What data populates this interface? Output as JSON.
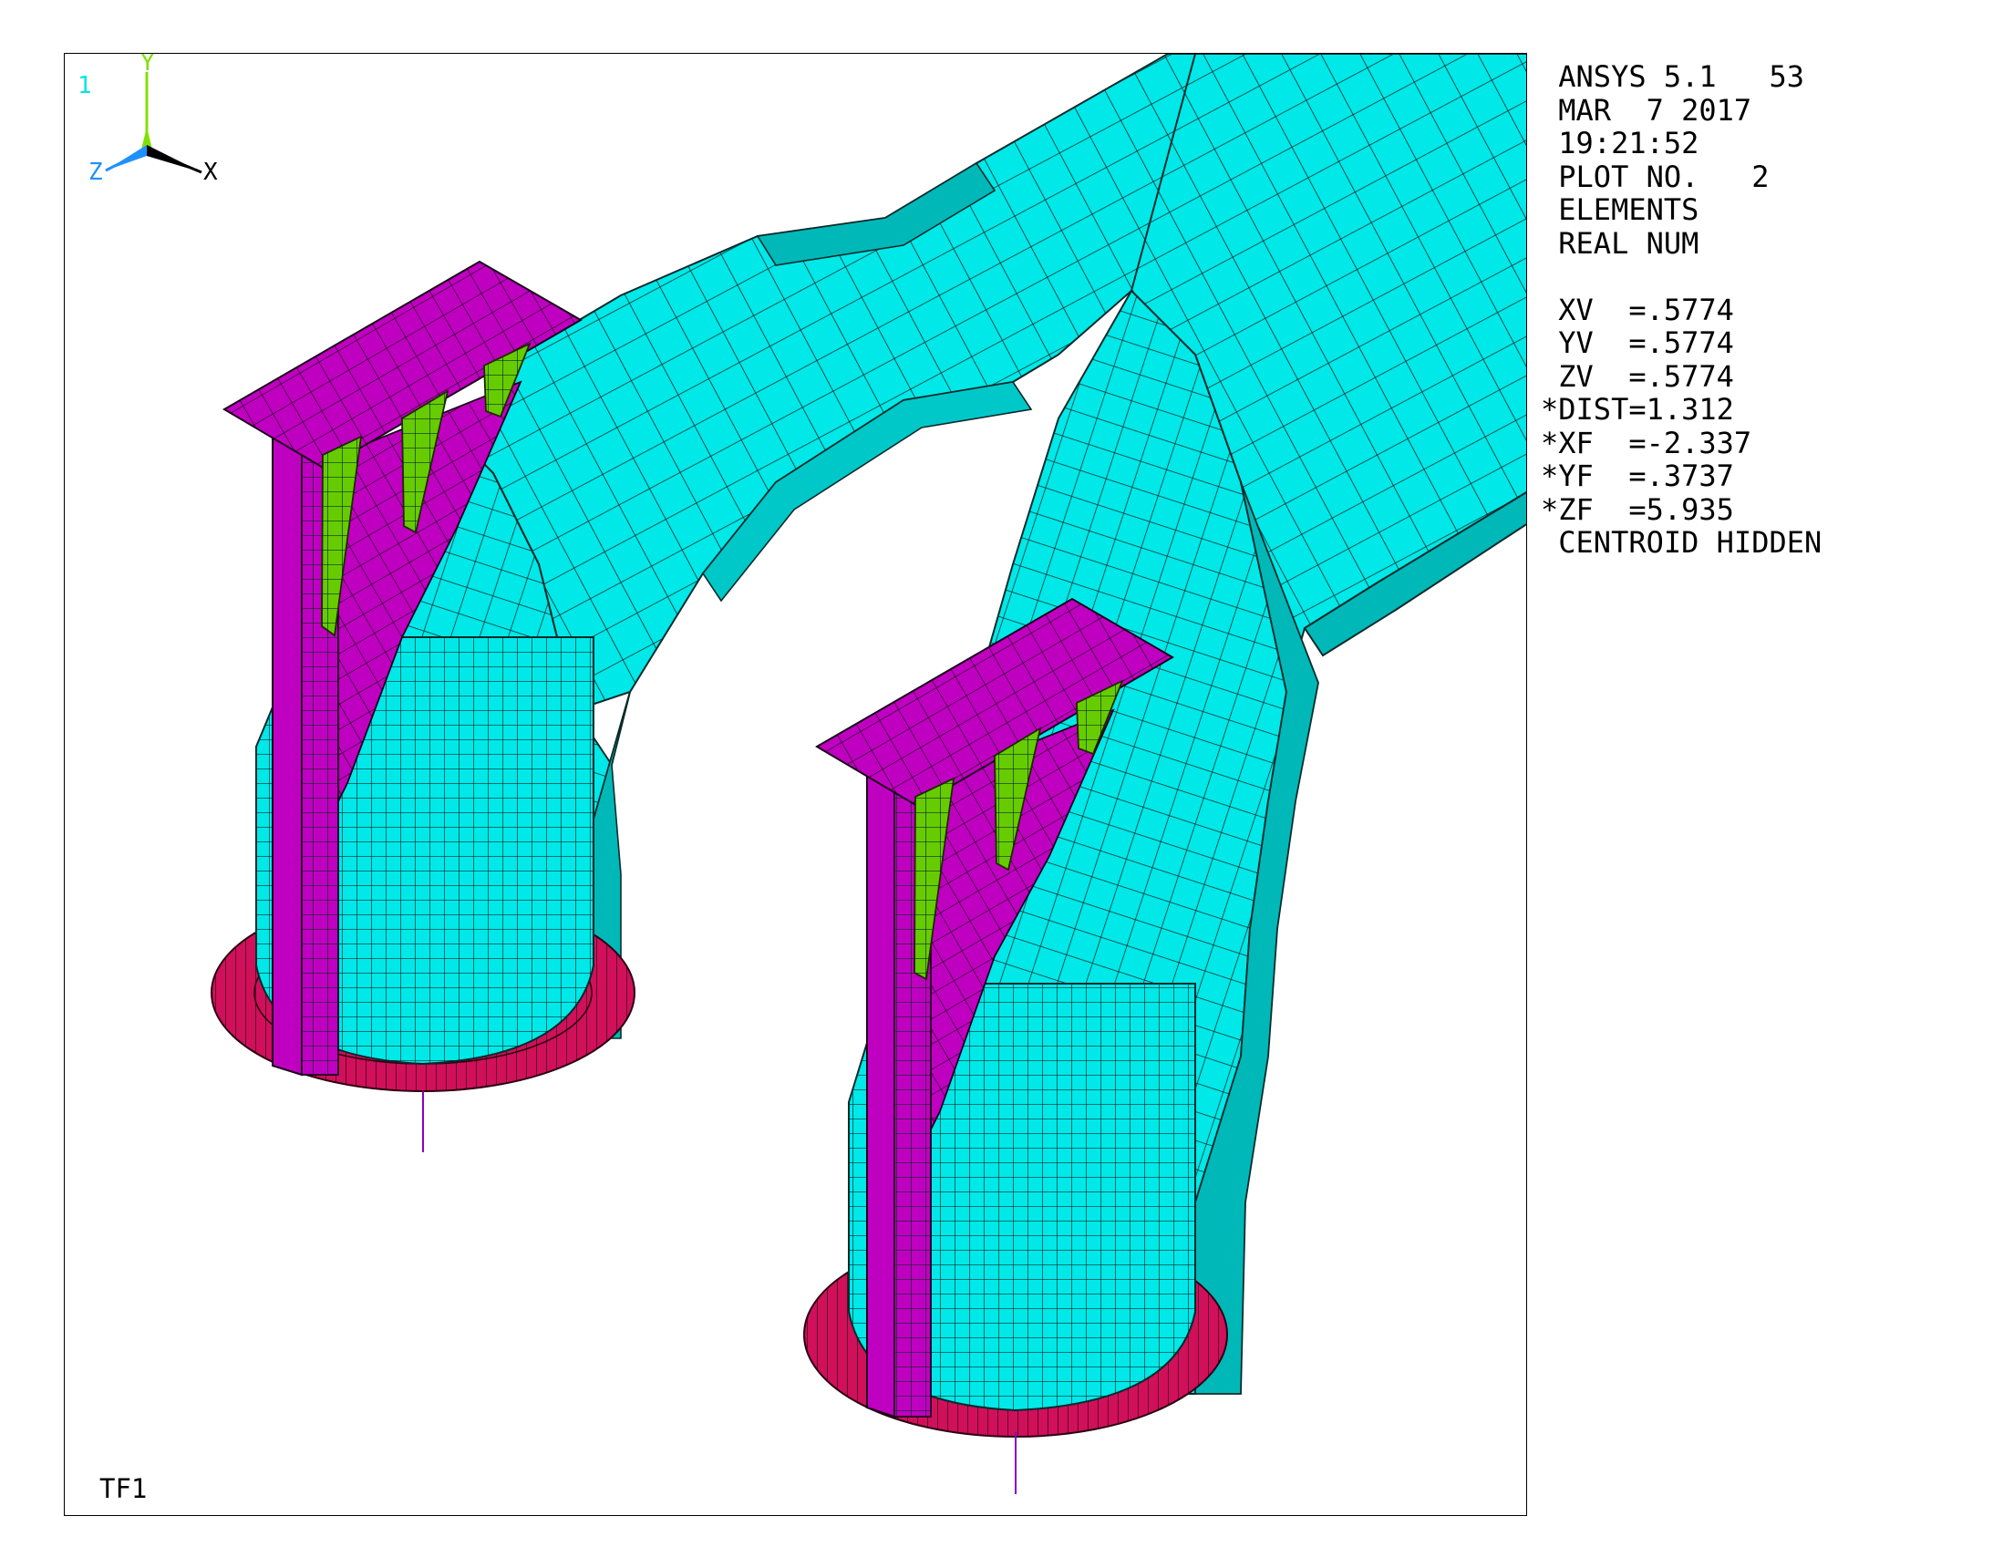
{
  "window": {
    "number": "1",
    "title_tag": "TF1"
  },
  "info": {
    "header_lines": [
      " ANSYS 5.1   53",
      " MAR  7 2017",
      " 19:21:52",
      " PLOT NO.   2",
      " ELEMENTS",
      " REAL NUM"
    ],
    "view_lines": [
      " XV  =.5774",
      " YV  =.5774",
      " ZV  =.5774",
      "*DIST=1.312",
      "*XF  =-2.337",
      "*YF  =.3737",
      "*ZF  =5.935",
      " CENTROID HIDDEN"
    ]
  },
  "triad": {
    "x": "X",
    "y": "Y",
    "z": "Z"
  },
  "colors": {
    "pipe": "#00e8e8",
    "pipe_shade": "#00b8b8",
    "bracket": "#c000c0",
    "stiffener": "#66cc00",
    "flange": "#d0105a",
    "mesh_line": "#0a2a2a",
    "axis_x": "#000000",
    "axis_y": "#80e000",
    "axis_z": "#1e90ff"
  },
  "icons": [
    "coordinate-triad-icon"
  ]
}
